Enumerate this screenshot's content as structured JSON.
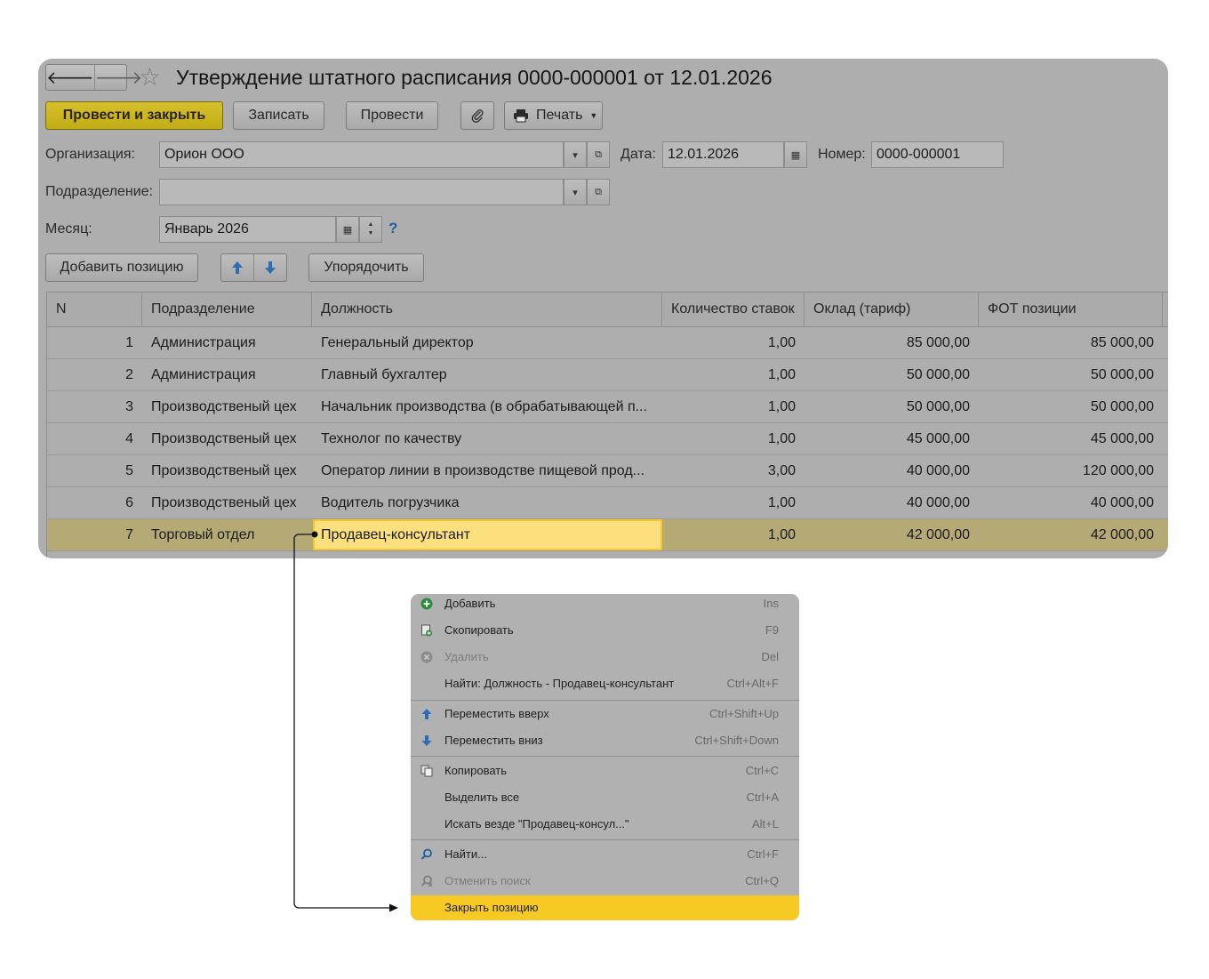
{
  "window": {
    "title": "Утверждение штатного расписания 0000-000001 от 12.01.2026",
    "nav_back": "🡐",
    "nav_forward": "🡒",
    "favorite_star": "☆"
  },
  "toolbar": {
    "post_close": "Провести и закрыть",
    "save": "Записать",
    "post": "Провести",
    "print": "Печать"
  },
  "form": {
    "org_label": "Организация:",
    "org_value": "Орион ООО",
    "date_label": "Дата:",
    "date_value": "12.01.2026",
    "number_label": "Номер:",
    "number_value": "0000-000001",
    "dept_label": "Подразделение:",
    "dept_value": "",
    "month_label": "Месяц:",
    "month_value": "Январь 2026",
    "help": "?"
  },
  "table_toolbar": {
    "add": "Добавить позицию",
    "sort": "Упорядочить"
  },
  "table": {
    "columns": [
      "N",
      "Подразделение",
      "Должность",
      "Количество ставок",
      "Оклад (тариф)",
      "ФОТ  позиции"
    ],
    "rows": [
      [
        "1",
        "Администрация",
        "Генеральный директор",
        "1,00",
        "85 000,00",
        "85 000,00"
      ],
      [
        "2",
        "Администрация",
        "Главный бухгалтер",
        "1,00",
        "50 000,00",
        "50 000,00"
      ],
      [
        "3",
        "Производственый цех",
        "Начальник производства (в обрабатывающей п...",
        "1,00",
        "50 000,00",
        "50 000,00"
      ],
      [
        "4",
        "Производственый цех",
        "Технолог по качеству",
        "1,00",
        "45 000,00",
        "45 000,00"
      ],
      [
        "5",
        "Производственый цех",
        "Оператор линии в производстве пищевой прод...",
        "3,00",
        "40 000,00",
        "120 000,00"
      ],
      [
        "6",
        "Производственый цех",
        "Водитель погрузчика",
        "1,00",
        "40 000,00",
        "40 000,00"
      ],
      [
        "7",
        "Торговый отдел",
        "Продавец-консультант",
        "1,00",
        "42 000,00",
        "42 000,00"
      ]
    ]
  },
  "context_menu": {
    "items": [
      {
        "label": "Добавить",
        "shortcut": "Ins"
      },
      {
        "label": "Скопировать",
        "shortcut": "F9"
      },
      {
        "label": "Удалить",
        "shortcut": "Del"
      },
      {
        "label": "Найти: Должность - Продавец-консультант",
        "shortcut": "Ctrl+Alt+F"
      },
      {
        "label": "Переместить вверх",
        "shortcut": "Ctrl+Shift+Up"
      },
      {
        "label": "Переместить вниз",
        "shortcut": "Ctrl+Shift+Down"
      },
      {
        "label": "Копировать",
        "shortcut": "Ctrl+C"
      },
      {
        "label": "Выделить все",
        "shortcut": "Ctrl+A"
      },
      {
        "label": "Искать везде \"Продавец-консул...\"",
        "shortcut": "Alt+L"
      },
      {
        "label": "Найти...",
        "shortcut": "Ctrl+F"
      },
      {
        "label": "Отменить поиск",
        "shortcut": "Ctrl+Q"
      },
      {
        "label": "Закрыть позицию",
        "shortcut": ""
      }
    ]
  },
  "colors": {
    "primary_button": "#c8b21c",
    "selected_row": "#b5a976",
    "current_cell": "#fbe07d",
    "menu_highlight": "#f6ca23"
  }
}
